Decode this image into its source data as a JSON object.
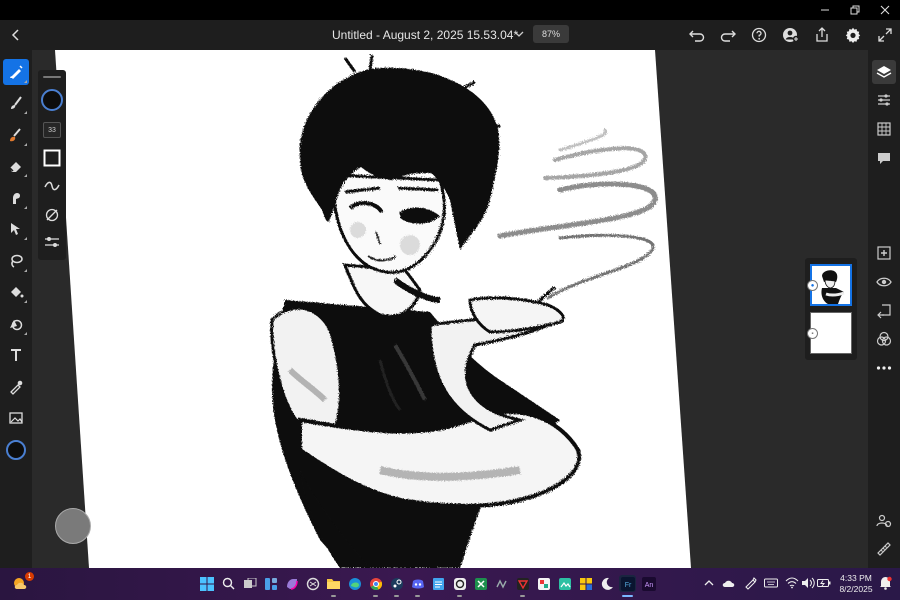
{
  "window": {
    "controls": [
      "minimize",
      "restore",
      "close"
    ]
  },
  "header": {
    "title": "Untitled - August 2, 2025 15.53.04*",
    "zoom": "87%",
    "icons": [
      "back-icon",
      "chevron-down-icon",
      "undo-icon",
      "redo-icon",
      "help-icon",
      "invite-icon",
      "share-icon",
      "settings-icon",
      "fullscreen-icon"
    ]
  },
  "left_toolbar": {
    "tools": [
      "pixel-brush",
      "live-brush",
      "fill-brush",
      "eraser",
      "smudge",
      "transform",
      "selection",
      "fill",
      "shapes",
      "text",
      "eyedropper",
      "image",
      "color"
    ]
  },
  "brush_panel": {
    "size": "33",
    "color": "#0d0d0d"
  },
  "layers": {
    "count": 2,
    "selected": 0
  },
  "right_toolbar": {
    "tools": [
      "layers",
      "layer-properties",
      "grid",
      "comments",
      "add-layer",
      "visibility",
      "import",
      "blend",
      "more",
      "timelapse",
      "ruler"
    ]
  },
  "taskbar": {
    "weather_badge": "1",
    "time": "4:33 PM",
    "date": "8/2/2025",
    "apps": [
      "start",
      "search",
      "task-view",
      "widgets",
      "copilot",
      "chatgpt",
      "explorer",
      "edge",
      "chrome",
      "steam",
      "discord",
      "notepad",
      "xbox",
      "excel",
      "premiere",
      "capcut",
      "vscode",
      "illustrator",
      "fresco",
      "animate"
    ],
    "app_labels": {
      "fresco": "Fr",
      "animate": "An"
    }
  },
  "colors": {
    "accent": "#1473e6",
    "panel": "#1e1e1e",
    "workspace": "#2a2a2a"
  }
}
